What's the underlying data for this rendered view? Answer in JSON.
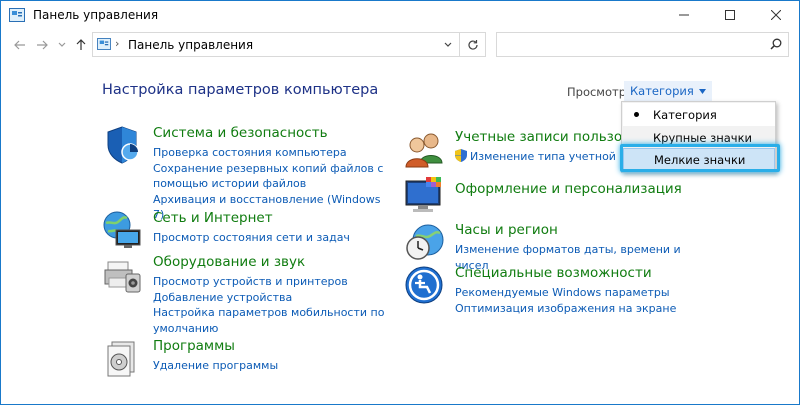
{
  "window": {
    "title": "Панель управления"
  },
  "address": {
    "path": "Панель управления",
    "separator": "›"
  },
  "search": {
    "value": "",
    "placeholder": ""
  },
  "main": {
    "heading": "Настройка параметров компьютера",
    "view_label": "Просмотр:",
    "view_value": "Категория"
  },
  "view_menu": {
    "items": [
      "Категория",
      "Крупные значки",
      "Мелкие значки"
    ],
    "selected": "Категория",
    "highlighted": "Мелкие значки"
  },
  "categories": [
    {
      "title": "Система и безопасность",
      "links": [
        "Проверка состояния компьютера",
        "Сохранение резервных копий файлов с помощью истории файлов",
        "Архивация и восстановление (Windows 7)"
      ]
    },
    {
      "title": "Сеть и Интернет",
      "links": [
        "Просмотр состояния сети и задач"
      ]
    },
    {
      "title": "Оборудование и звук",
      "links": [
        "Просмотр устройств и принтеров",
        "Добавление устройства",
        "Настройка параметров мобильности по умолчанию"
      ]
    },
    {
      "title": "Программы",
      "links": [
        "Удаление программы"
      ]
    },
    {
      "title": "Учетные записи пользователей",
      "links": [
        "Изменение типа учетной записи"
      ]
    },
    {
      "title": "Оформление и персонализация",
      "links": []
    },
    {
      "title": "Часы и регион",
      "links": [
        "Изменение форматов даты, времени и чисел"
      ]
    },
    {
      "title": "Специальные возможности",
      "links": [
        "Рекомендуемые Windows параметры",
        "Оптимизация изображения на экране"
      ]
    }
  ],
  "colors": {
    "heading": "#1e3287",
    "category_title": "#107c10",
    "link": "#0c5bb5",
    "highlight": "#2aaee8"
  }
}
